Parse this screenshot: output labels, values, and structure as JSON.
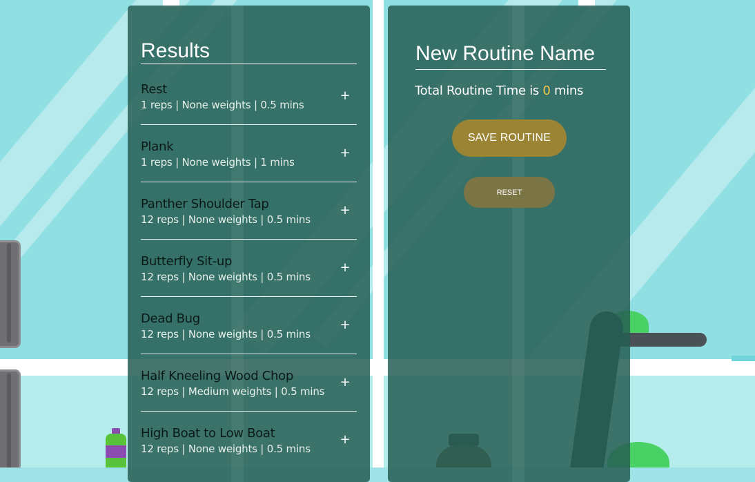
{
  "results": {
    "title": "Results",
    "add_symbol": "+",
    "items": [
      {
        "name": "Rest",
        "meta": "1 reps | None weights | 0.5 mins"
      },
      {
        "name": "Plank",
        "meta": "1 reps | None weights | 1 mins"
      },
      {
        "name": "Panther Shoulder Tap",
        "meta": "12 reps | None weights | 0.5 mins"
      },
      {
        "name": "Butterfly Sit-up",
        "meta": "12 reps | None weights | 0.5 mins"
      },
      {
        "name": "Dead Bug",
        "meta": "12 reps | None weights | 0.5 mins"
      },
      {
        "name": "Half Kneeling Wood Chop",
        "meta": "12 reps | Medium weights | 0.5 mins"
      },
      {
        "name": "High Boat to Low Boat",
        "meta": "12 reps | None weights | 0.5 mins"
      }
    ]
  },
  "routine": {
    "name_placeholder": "New Routine Name",
    "total_prefix": "Total Routine Time is",
    "total_value": "0",
    "total_suffix": "mins",
    "save_label": "SAVE ROUTINE",
    "reset_label": "RESET"
  },
  "colors": {
    "panel": "#265e54",
    "accent_gold": "#f2c744",
    "save_button": "#9b8535",
    "reset_button": "#7b7545"
  }
}
